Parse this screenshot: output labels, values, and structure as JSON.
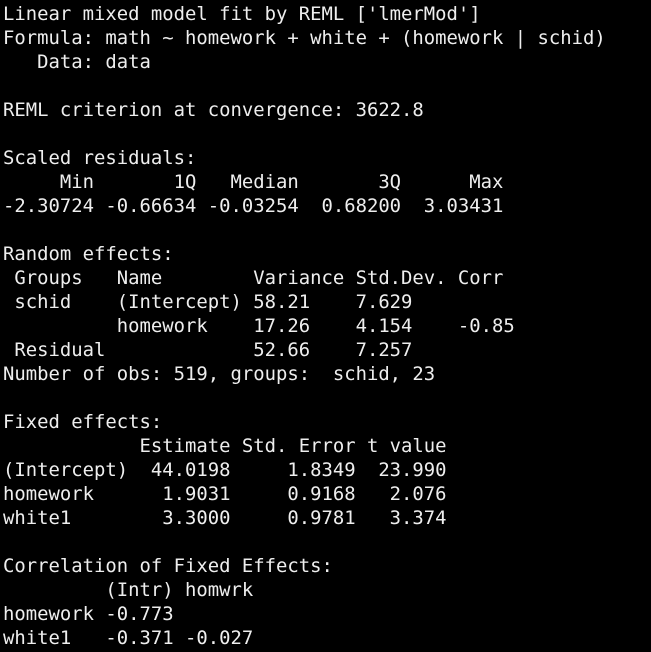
{
  "console": {
    "lines": [
      "Linear mixed model fit by REML ['lmerMod']",
      "Formula: math ~ homework + white + (homework | schid)",
      "   Data: data",
      "",
      "REML criterion at convergence: 3622.8",
      "",
      "Scaled residuals:",
      "     Min       1Q   Median       3Q      Max",
      "-2.30724 -0.66634 -0.03254  0.68200  3.03431",
      "",
      "Random effects:",
      " Groups   Name        Variance Std.Dev. Corr",
      " schid    (Intercept) 58.21    7.629",
      "          homework    17.26    4.154    -0.85",
      " Residual             52.66    7.257",
      "Number of obs: 519, groups:  schid, 23",
      "",
      "Fixed effects:",
      "            Estimate Std. Error t value",
      "(Intercept)  44.0198     1.8349  23.990",
      "homework      1.9031     0.9168   2.076",
      "white1        3.3000     0.9781   3.374",
      "",
      "Correlation of Fixed Effects:",
      "         (Intr) homwrk",
      "homework -0.773",
      "white1   -0.371 -0.027"
    ]
  }
}
